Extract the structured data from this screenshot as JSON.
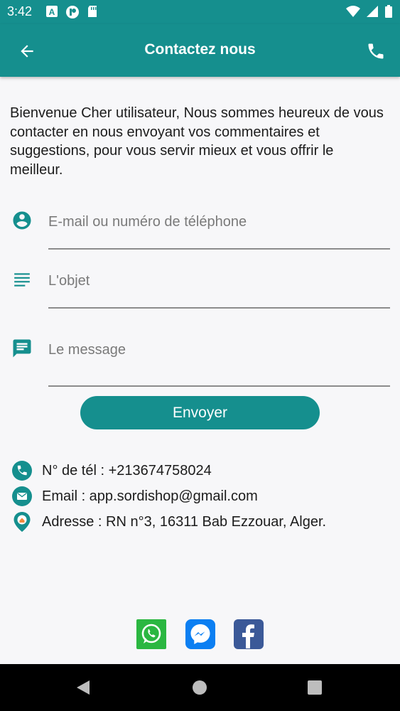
{
  "status_bar": {
    "time": "3:42",
    "icons_left": [
      "a-badge-icon",
      "p-badge-icon",
      "sd-card-icon"
    ],
    "icons_right": [
      "wifi-icon",
      "signal-icon",
      "battery-icon"
    ]
  },
  "app_bar": {
    "title": "Contactez nous",
    "back_icon": "arrow-left-icon",
    "call_icon": "phone-icon",
    "color": "#158f8e"
  },
  "intro_text": "Bienvenue Cher utilisateur, Nous sommes heureux de vous contacter en nous envoyant vos commentaires et suggestions, pour vous servir mieux et vous offrir le meilleur.",
  "form": {
    "contact_placeholder": "E-mail ou numéro de téléphone",
    "contact_value": "",
    "subject_placeholder": "L'objet",
    "subject_value": "",
    "message_placeholder": "Le message",
    "message_value": "",
    "send_label": "Envoyer"
  },
  "contact_info": {
    "phone": "N° de tél : +213674758024",
    "email": "Email : app.sordishop@gmail.com",
    "address": "Adresse : RN n°3, 16311 Bab Ezzouar, Alger."
  },
  "social": [
    "whatsapp-icon",
    "messenger-icon",
    "facebook-icon"
  ],
  "nav": [
    "back-triangle-icon",
    "home-circle-icon",
    "recents-square-icon"
  ]
}
